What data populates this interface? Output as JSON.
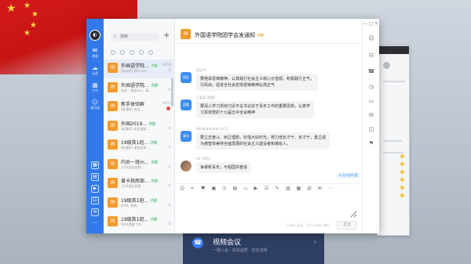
{
  "app": {
    "rail": {
      "avatar_text": "◐",
      "items": [
        {
          "icon": "chat-icon",
          "glyph": "✉",
          "label": "消息"
        },
        {
          "icon": "cloud-icon",
          "glyph": "☁",
          "label": "云盘"
        },
        {
          "icon": "work-icon",
          "glyph": "▦",
          "label": "工作"
        },
        {
          "icon": "contacts-icon",
          "glyph": "☺",
          "label": "通讯录"
        }
      ],
      "bottom_icons": [
        "calendar-icon",
        "document-icon",
        "meeting-icon",
        "task-icon",
        "mail-icon",
        "approval-icon",
        "more-icon"
      ]
    },
    "list": {
      "search_placeholder": "搜索",
      "add_label": "+",
      "conversations": [
        {
          "name": "外国语学院...",
          "tag": "内部",
          "time": "10:54",
          "msg": "[有@我] 你好 xxx",
          "status": "mute"
        },
        {
          "name": "外国语学院...",
          "tag": "内部",
          "time": "",
          "msg": "你好，我是xxx，请...",
          "status": "mute"
        },
        {
          "name": "新手体验群",
          "tag": "",
          "time": "10:57",
          "msg": "[群通知] 欢迎...",
          "status": "badge"
        },
        {
          "name": "外国2019...",
          "tag": "内部",
          "time": "",
          "msg": "[新通知] 班会通知...",
          "status": "mute"
        },
        {
          "name": "19级英1班...",
          "tag": "内部",
          "time": "",
          "msg": "[新通知] 课程安排...",
          "status": "mute"
        },
        {
          "name": "内员一班m...",
          "tag": "内部",
          "time": "",
          "msg": "王XX发起投票...",
          "status": "mute"
        },
        {
          "name": "曾卡指挥部...",
          "tag": "内部",
          "time": "",
          "msg": "王XX发起投票...",
          "status": "mute"
        },
        {
          "name": "19级英1班...",
          "tag": "内部",
          "time": "",
          "msg": "李XX: 收到...",
          "status": "mute"
        },
        {
          "name": "19级英1班...",
          "tag": "内部",
          "time": "",
          "msg": "李XX提醒了你...",
          "status": "mute"
        }
      ]
    },
    "chat": {
      "title": "外国语学院团学会发通知",
      "title_tag": "内部",
      "messages": [
        {
          "sender": "团支书",
          "avatar": "团支",
          "text_lines": [
            "要继承雷锋精神，认真践行社会主义核心价值观，积极践行正气，",
            "引风尚，促进全社会宏扬雷锋精神弘扬正气"
          ]
        },
        {
          "sender": "王某某 (团委)",
          "avatar": "团委",
          "text_lines": [
            "要深入学习贯彻习近平总书记关于青年工作的重要思想，认真学",
            "习贯彻党的十九届五中全会精神"
          ]
        },
        {
          "sender": "知识新青年发布 (学习)",
          "avatar": "青年",
          "text_lines": [
            "要立志奋斗、树立理想，珍惜大好时光，努力增长才干、长才干，勇立成",
            "为德智体美劳全面发展的社会主义建设者和接班人。"
          ]
        },
        {
          "sender": "XX (学员)",
          "avatar": "",
          "text_lines": [
            "争做新青年，与祖国共奋进"
          ]
        }
      ],
      "read_note": "◔ 仅内部可看",
      "toolbar_icons": [
        "emoji-icon",
        "scissors-icon",
        "like-icon",
        "image-icon",
        "clock-icon",
        "file-icon",
        "folder-icon",
        "video-icon",
        "check-icon",
        "doc-icon",
        "clipboard-icon",
        "poll-icon",
        "at-icon",
        "mail-icon",
        "more-icon"
      ],
      "toolbar_glyphs": [
        "☺",
        "✂",
        "♥",
        "▣",
        "◷",
        "▤",
        "▭",
        "▶",
        "☑",
        "✎",
        "▥",
        "▦",
        "@",
        "✉",
        "⋯"
      ],
      "composer_value": "",
      "send_hint": "Enter 发送，Ctrl+Enter 换行",
      "send_label": "发送"
    },
    "tools": {
      "window_controls": [
        "—",
        "□",
        "✕"
      ],
      "items": [
        {
          "icon": "smile-icon",
          "glyph": "☺"
        },
        {
          "icon": "group-icon",
          "glyph": "☷"
        },
        {
          "icon": "phone-icon",
          "glyph": "☎"
        },
        {
          "icon": "history-icon",
          "glyph": "◷"
        },
        {
          "icon": "folder-icon",
          "glyph": "▭"
        },
        {
          "icon": "message-icon",
          "glyph": "✉"
        },
        {
          "icon": "pin-icon",
          "glyph": "◫"
        },
        {
          "icon": "flag-icon",
          "glyph": "⚑"
        }
      ]
    }
  },
  "desktop": {
    "video_title": "视频会议",
    "video_sub": "一键入会 · 高清画质 · 稳定流畅"
  }
}
